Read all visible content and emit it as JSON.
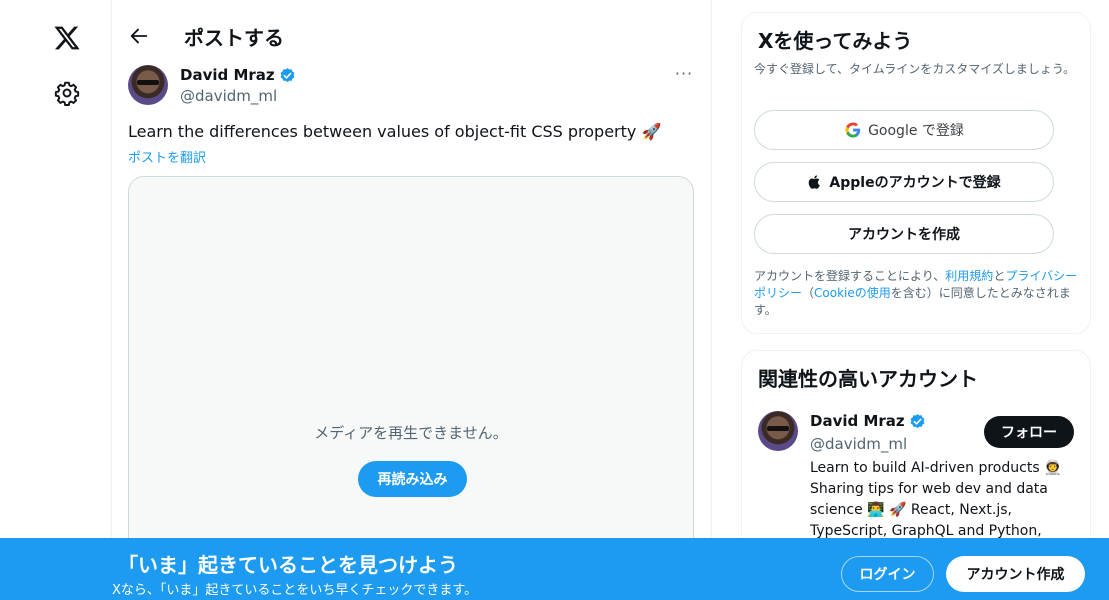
{
  "nav": {
    "logo_icon": "x-logo-icon",
    "settings_icon": "gear-icon"
  },
  "header": {
    "title": "ポストする",
    "back_icon": "arrow-left-icon"
  },
  "post": {
    "author_name": "David Mraz",
    "author_handle": "@davidm_ml",
    "more": "···",
    "text": "Learn the differences between values of object-fit CSS property 🚀",
    "translate": "ポストを翻訳",
    "media_message": "メディアを再生できません。",
    "reload_label": "再読み込み"
  },
  "signup": {
    "title": "Xを使ってみよう",
    "subtitle": "今すぐ登録して、タイムラインをカスタマイズしましょう。",
    "google_label": "Google で登録",
    "apple_label": "Appleのアカウントで登録",
    "create_label": "アカウントを作成",
    "legal_prefix": "アカウントを登録することにより、",
    "terms": "利用規約",
    "and": "と",
    "privacy": "プライバシーポリシー",
    "paren_open": "（",
    "cookie": "Cookieの使用",
    "legal_suffix": "を含む）に同意したとみなされます。"
  },
  "related": {
    "title": "関連性の高いアカウント",
    "name": "David Mraz",
    "handle": "@davidm_ml",
    "follow_label": "フォロー",
    "bio": "Learn to build AI-driven products 👨‍🚀 Sharing tips for web dev and data science 👨‍💻 🚀 React, Next.js, TypeScript, GraphQL and Python, Co-"
  },
  "banner": {
    "title": "「いま」起きていることを見つけよう",
    "subtitle": "Xなら、「いま」起きていることをいち早くチェックできます。",
    "login_label": "ログイン",
    "create_label": "アカウント作成"
  },
  "colors": {
    "accent": "#1d9bf0",
    "text": "#0f1419",
    "muted": "#536471"
  }
}
